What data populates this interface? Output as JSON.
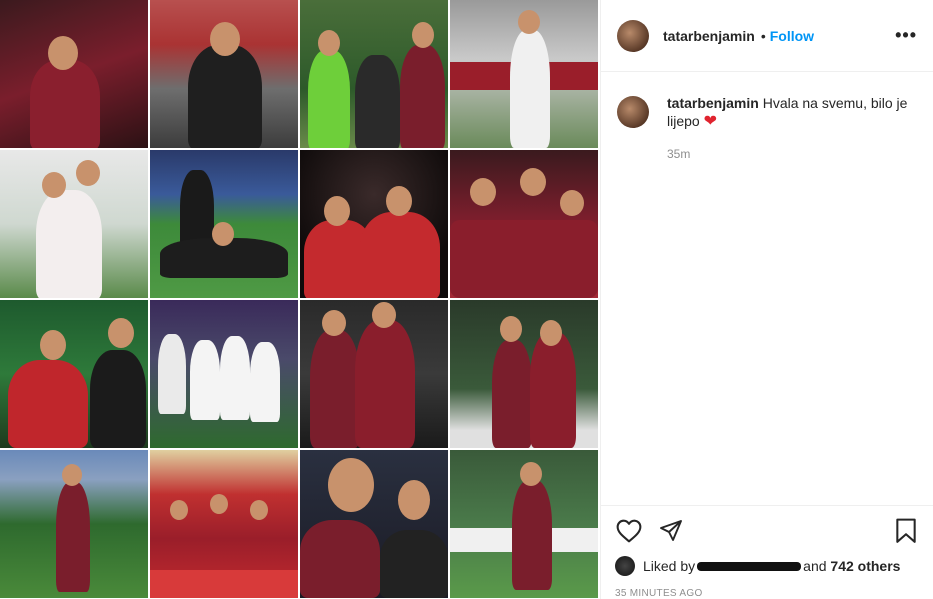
{
  "post": {
    "username": "tatarbenjamin",
    "separator": "•",
    "follow_label": "Follow",
    "more_label": "•••"
  },
  "caption": {
    "username": "tatarbenjamin",
    "text": "Hvala na svemu, bilo je lijepo",
    "emoji": "❤",
    "time": "35m"
  },
  "likes": {
    "prefix": "Liked by",
    "connector": "and",
    "count_text": "742 others"
  },
  "posted_ago": "35 MINUTES AGO",
  "icons": [
    "heart-icon",
    "share-icon",
    "bookmark-icon"
  ],
  "colors": {
    "accent": "#0095f6",
    "maroon": "#7a1e2c",
    "text": "#262626",
    "muted": "#8e8e8e"
  }
}
